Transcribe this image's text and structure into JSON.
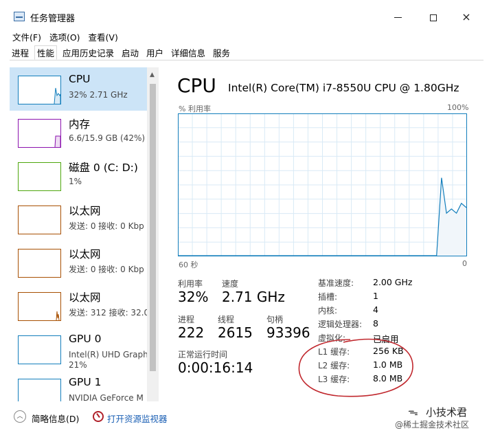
{
  "window": {
    "title": "任务管理器",
    "controls": {
      "minimize": "minimize-icon",
      "maximize": "maximize-icon",
      "close": "×"
    }
  },
  "menu": [
    "文件(F)",
    "选项(O)",
    "查看(V)"
  ],
  "tabs": [
    {
      "label": "进程",
      "active": false
    },
    {
      "label": "性能",
      "active": true
    },
    {
      "label": "应用历史记录",
      "active": false
    },
    {
      "label": "启动",
      "active": false
    },
    {
      "label": "用户",
      "active": false
    },
    {
      "label": "详细信息",
      "active": false
    },
    {
      "label": "服务",
      "active": false
    }
  ],
  "sidebar": {
    "items": [
      {
        "name": "CPU",
        "sub": "32% 2.71 GHz",
        "color": "#117dbb",
        "selected": true
      },
      {
        "name": "内存",
        "sub": "6.6/15.9 GB (42%)",
        "color": "#8b12ae",
        "selected": false
      },
      {
        "name": "磁盘 0 (C: D:)",
        "sub": "1%",
        "color": "#4da60c",
        "selected": false
      },
      {
        "name": "以太网",
        "sub": "发送: 0 接收: 0 Kbp",
        "color": "#a74f01",
        "selected": false
      },
      {
        "name": "以太网",
        "sub": "发送: 0 接收: 0 Kbp",
        "color": "#a74f01",
        "selected": false
      },
      {
        "name": "以太网",
        "sub": "发送: 312 接收: 32.0",
        "color": "#a74f01",
        "selected": false
      },
      {
        "name": "GPU 0",
        "sub": "Intel(R) UHD Graph",
        "sub2": "21%",
        "color": "#117dbb",
        "selected": false
      },
      {
        "name": "GPU 1",
        "sub": "NVIDIA GeForce M",
        "color": "#117dbb",
        "selected": false
      }
    ]
  },
  "main": {
    "title": "CPU",
    "model": "Intel(R) Core(TM) i7-8550U CPU @ 1.80GHz",
    "axis_top_left": "% 利用率",
    "axis_top_right": "100%",
    "axis_bottom_left": "60 秒",
    "axis_bottom_right": "0",
    "graph_color": "#117dbb",
    "graph_fill": "#f1f6fa",
    "graph_samples_percent": [
      0,
      0,
      0,
      0,
      0,
      0,
      0,
      0,
      0,
      0,
      0,
      0,
      0,
      0,
      0,
      0,
      0,
      0,
      0,
      0,
      0,
      0,
      0,
      0,
      0,
      0,
      0,
      0,
      0,
      0,
      0,
      0,
      0,
      0,
      0,
      0,
      0,
      0,
      0,
      0,
      0,
      0,
      0,
      0,
      0,
      0,
      0,
      0,
      0,
      0,
      0,
      0,
      0,
      55,
      30,
      33,
      30,
      37,
      34
    ],
    "stats": {
      "utilization_label": "利用率",
      "utilization": "32%",
      "speed_label": "速度",
      "speed": "2.71 GHz",
      "processes_label": "进程",
      "processes": "222",
      "threads_label": "线程",
      "threads": "2615",
      "handles_label": "句柄",
      "handles": "93396",
      "uptime_label": "正常运行时间",
      "uptime": "0:00:16:14"
    },
    "specs": [
      {
        "label": "基准速度:",
        "value": "2.00 GHz"
      },
      {
        "label": "插槽:",
        "value": "1"
      },
      {
        "label": "内核:",
        "value": "4"
      },
      {
        "label": "逻辑处理器:",
        "value": "8"
      },
      {
        "label": "虚拟化:",
        "value": "已启用"
      },
      {
        "label": "L1 缓存:",
        "value": "256 KB"
      },
      {
        "label": "L2 缓存:",
        "value": "1.0 MB"
      },
      {
        "label": "L3 缓存:",
        "value": "8.0 MB"
      }
    ],
    "annotation_color": "#c0272d"
  },
  "footer": {
    "collapse_label": "简略信息(D)",
    "resmon_label": "打开资源监视器"
  },
  "watermark": {
    "brand": "小技术君",
    "caption": "@稀土掘金技术社区"
  }
}
